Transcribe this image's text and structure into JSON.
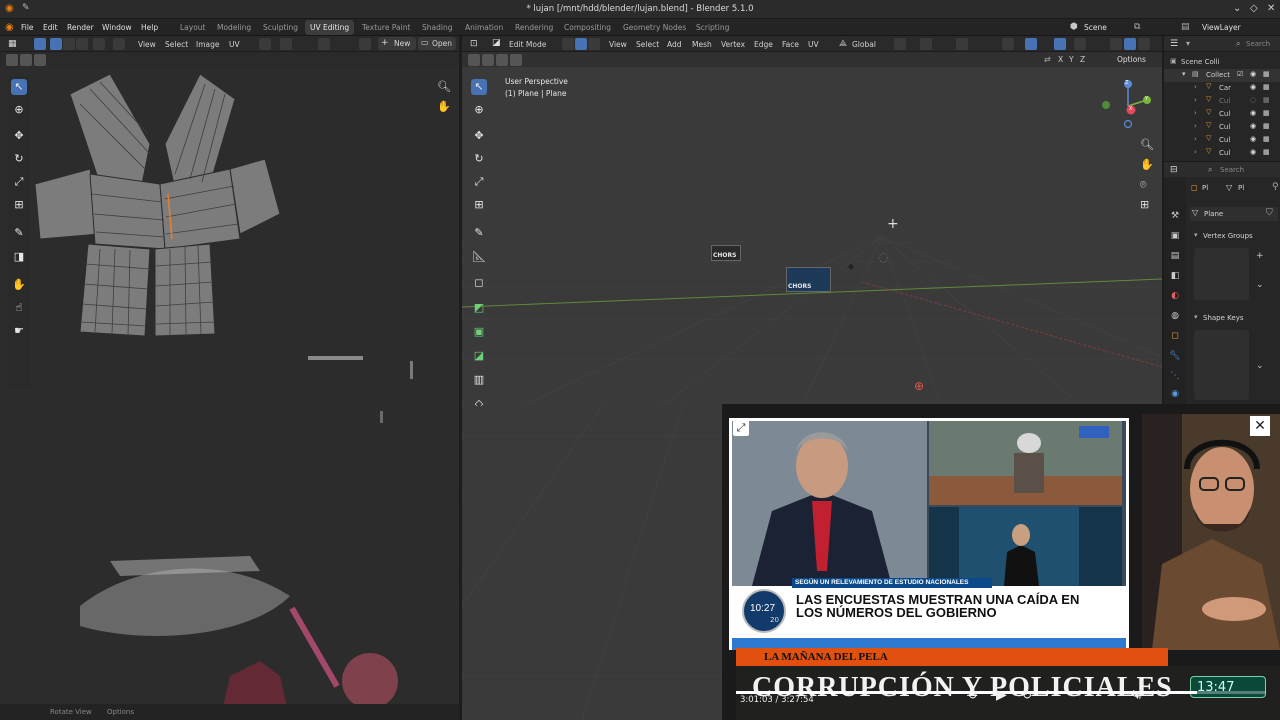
{
  "window": {
    "title": "* lujan [/mnt/hdd/blender/lujan.blend] - Blender 5.1.0",
    "controls": [
      "minimize-icon",
      "maximize-icon",
      "close-icon"
    ]
  },
  "menubar": {
    "items": [
      "File",
      "Edit",
      "Render",
      "Window",
      "Help"
    ],
    "workspaces": [
      "Layout",
      "Modeling",
      "Sculpting",
      "UV Editing",
      "Texture Paint",
      "Shading",
      "Animation",
      "Rendering",
      "Compositing",
      "Geometry Nodes",
      "Scripting"
    ],
    "active_workspace": "UV Editing",
    "scene_label": "Scene",
    "view_layer_label": "ViewLayer"
  },
  "uv_editor": {
    "menu": [
      "View",
      "Select",
      "Image",
      "UV"
    ],
    "new_label": "New",
    "open_label": "Open",
    "footer_left": "Rotate View",
    "footer_right": "Options"
  },
  "viewport": {
    "mode": "Edit Mode",
    "menu": [
      "View",
      "Select",
      "Add",
      "Mesh",
      "Vertex",
      "Edge",
      "Face",
      "UV"
    ],
    "orientation": "Global",
    "axes": [
      "X",
      "Y",
      "Z"
    ],
    "options_label": "Options",
    "overlay_title": "User Perspective",
    "overlay_subtitle": "(1) Plane | Plane",
    "image_labels": [
      "CHORS",
      "CHORS"
    ],
    "nav_gizmo": {
      "z": "Z",
      "y": "Y",
      "x": "X"
    }
  },
  "outliner": {
    "scene_collection": "Scene Colli",
    "collection": "Collect",
    "items": [
      "Car",
      "Cul",
      "Cul",
      "Cul",
      "Cul",
      "Cul"
    ],
    "search_placeholder": "Search"
  },
  "properties": {
    "search_placeholder": "Search",
    "breadcrumb_a": "Pl",
    "breadcrumb_b": "Pl",
    "object_name": "Plane",
    "vertex_groups_label": "Vertex Groups",
    "shape_keys_label": "Shape Keys"
  },
  "video_overlay": {
    "news_context": "SEGÚN UN RELEVAMIENTO DE ESTUDIO NACIONALES",
    "headline_line1": "LAS ENCUESTAS MUESTRAN UNA CAÍDA EN",
    "headline_line2": "LOS NÚMEROS DEL GOBIERNO",
    "clock_time": "10:27",
    "clock_sub": "20",
    "show_name": "LA MAÑANA DEL PELA",
    "big_title": "CORRUPCIÓN Y POLICIALES",
    "stream_clock": "13:47",
    "time_current": "3:01:03",
    "time_total": "3:27:54",
    "time_separator": " / ",
    "progress": 0.87
  },
  "colors": {
    "accent": "#4772b3",
    "background": "#3a3a3a",
    "panel": "#2c2c2c",
    "news_red": "#e25a18",
    "mesh": "#8a8a8a"
  }
}
